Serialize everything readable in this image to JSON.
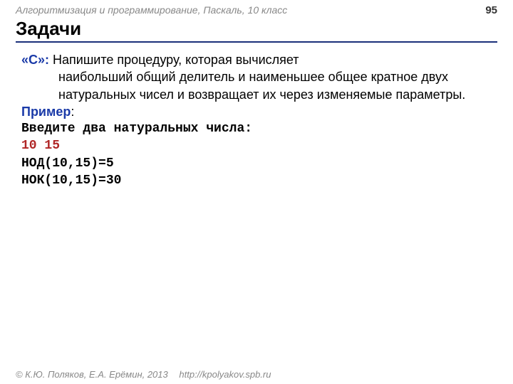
{
  "header": {
    "course": "Алгоритмизация и программирование, Паскаль, 10 класс",
    "page": "95"
  },
  "title": "Задачи",
  "task": {
    "marker": "«C»:",
    "text_first_line": " Напишите процедуру, которая вычисляет",
    "text_rest": "наибольший общий делитель и наименьшее общее кратное двух натуральных чисел и возвращает их через изменяемые параметры."
  },
  "example": {
    "label": "Пример",
    "colon": ":",
    "prompt": "Введите два натуральных числа:",
    "input": "10 15",
    "out1": "НОД(10,15)=5",
    "out2": "НОК(10,15)=30"
  },
  "footer": {
    "copyright": "© К.Ю. Поляков, Е.А. Ерёмин, 2013",
    "url": "http://kpolyakov.spb.ru"
  }
}
